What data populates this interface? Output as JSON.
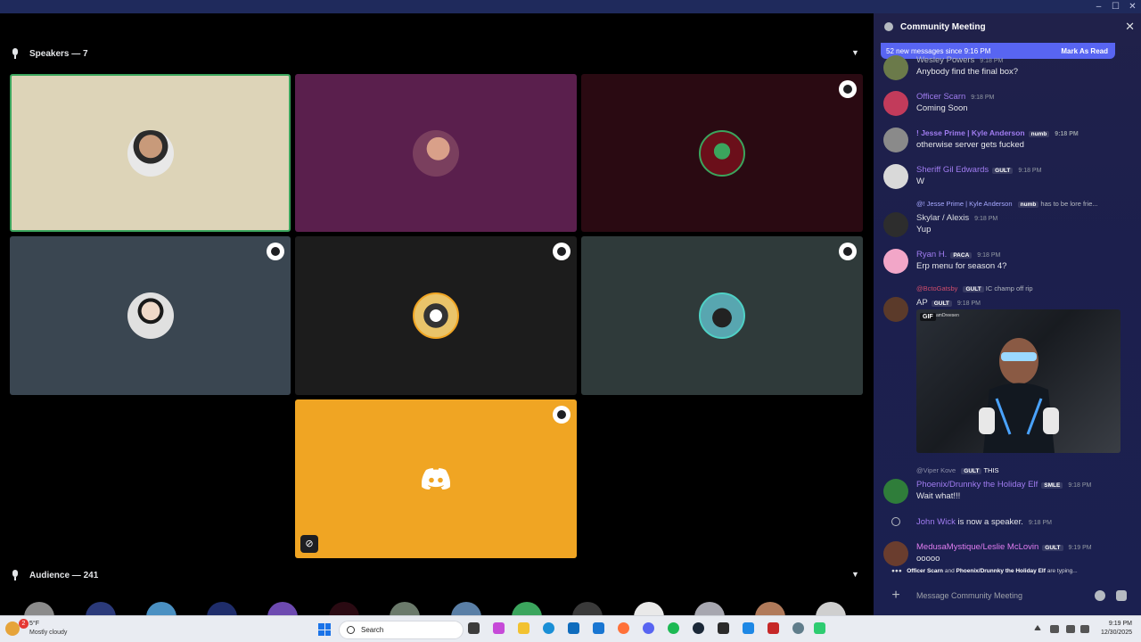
{
  "window": {
    "controls": [
      "–",
      "☐",
      "✕"
    ]
  },
  "stage": {
    "speakers_label": "Speakers — 7",
    "audience_label": "Audience — 241",
    "tiles": [
      {
        "id": "speaker-1",
        "bg": "#ddd4b8",
        "active": true,
        "moderator": false
      },
      {
        "id": "speaker-2",
        "bg": "#5a1f4d",
        "active": false,
        "moderator": false
      },
      {
        "id": "speaker-3",
        "bg": "#2a0a12",
        "active": false,
        "moderator": true
      },
      {
        "id": "speaker-4",
        "bg": "#3a4651",
        "active": false,
        "moderator": true
      },
      {
        "id": "speaker-5",
        "bg": "#1c1c1c",
        "active": false,
        "moderator": true
      },
      {
        "id": "speaker-6",
        "bg": "#2f3a3a",
        "active": false,
        "moderator": true
      },
      {
        "id": "speaker-7",
        "bg": "#f0a523",
        "active": false,
        "moderator": true,
        "camera_off": true
      }
    ]
  },
  "chat": {
    "title": "Community Meeting",
    "new_messages": "52 new messages since 9:16 PM",
    "mark_as_read": "Mark As Read",
    "messages": [
      {
        "name": "Wesley Powers",
        "time": "9:18 PM",
        "text": "Anybody find the final box?",
        "color": "#b5bac1"
      },
      {
        "name": "Officer Scarn",
        "time": "9:18 PM",
        "text": "Coming Soon",
        "color": "#a07cf0"
      },
      {
        "name": "! Jesse Prime | Kyle Anderson",
        "tag": "numb",
        "time": "9:18 PM",
        "text": "otherwise server gets fucked",
        "color": "#a07cf0"
      },
      {
        "name": "Sheriff Gil Edwards",
        "tag": "GULT",
        "time": "9:18 PM",
        "text": "W",
        "color": "#a07cf0"
      },
      {
        "reply_name": "@! Jesse Prime | Kyle Anderson",
        "reply_tag": "numb",
        "reply_text": "has to be lore frie...",
        "name": "Skylar / Alexis",
        "time": "9:18 PM",
        "text": "Yup",
        "color": "#dbdee1"
      },
      {
        "name": "Ryan H.",
        "tag": "PACA",
        "time": "9:18 PM",
        "text": "Erp menu for season 4?",
        "color": "#a07cf0"
      },
      {
        "reply_name": "@BctoGatsby",
        "reply_tag": "GULT",
        "reply_text": "IC champ off rip",
        "name": "AP",
        "tag": "GULT",
        "time": "9:18 PM",
        "text": "",
        "color": "#dbdee1"
      },
      {
        "reply_name": "@Viper Kove",
        "reply_tag": "GULT",
        "reply_text": "THIS",
        "name": "Phoenix/Drunnky the Holiday Elf",
        "tag": "SMLE",
        "time": "9:18 PM",
        "text": "Wait what!!!",
        "color": "#a07cf0"
      },
      {
        "name": "John Wick",
        "system": "is now a speaker.",
        "time": "9:18 PM",
        "color": "#a07cf0"
      },
      {
        "name": "MedusaMystique/Leslie McLovin",
        "tag": "GULT",
        "time": "9:19 PM",
        "text": "ooooo",
        "color": "#e07cf0"
      }
    ],
    "gif_label": "GIF",
    "gif_source": "amDreesen",
    "typing_a": "Officer Scarn",
    "typing_and": " and ",
    "typing_b": "Phoenix/Drunnky the Holiday Elf",
    "typing_suffix": " are typing...",
    "composer_placeholder": "Message Community Meeting"
  },
  "taskbar": {
    "temp": "5°F",
    "weather": "Mostly cloudy",
    "notif_count": "2",
    "search_label": "Search",
    "time": "9:19 PM",
    "date": "12/30/2025"
  }
}
